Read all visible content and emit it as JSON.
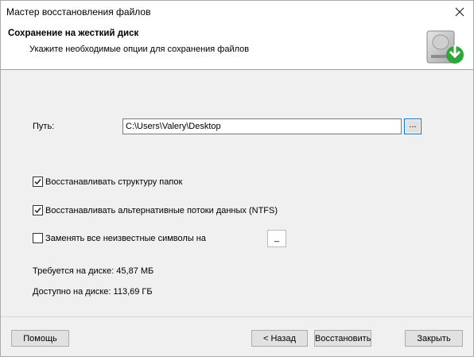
{
  "window": {
    "title": "Мастер восстановления файлов"
  },
  "header": {
    "title": "Сохранение на жесткий диск",
    "subtitle": "Укажите необходимые опции для сохранения файлов"
  },
  "path": {
    "label": "Путь:",
    "value": "C:\\Users\\Valery\\Desktop",
    "browse_label": "..."
  },
  "options": {
    "restore_structure": {
      "label": "Восстанавливать структуру папок",
      "checked": true
    },
    "restore_streams": {
      "label": "Восстанавливать альтернативные потоки данных (NTFS)",
      "checked": true
    },
    "replace_symbols": {
      "label": "Заменять все неизвестные символы на",
      "checked": false,
      "replacement": "_"
    }
  },
  "disk": {
    "required": "Требуется на диске: 45,87 МБ",
    "available": "Доступно на диске: 113,69 ГБ"
  },
  "buttons": {
    "help": "Помощь",
    "back": "< Назад",
    "restore": "Восстановить",
    "close": "Закрыть"
  },
  "colors": {
    "focus_border": "#0078d7",
    "icon_green": "#2fa53a"
  }
}
